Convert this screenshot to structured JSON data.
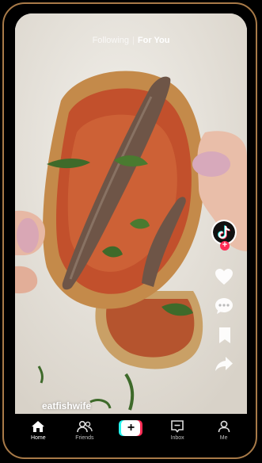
{
  "top_nav": {
    "following": "Following",
    "for_you": "For You"
  },
  "post": {
    "author": "eatfishwife"
  },
  "tabs": [
    {
      "label": "Home",
      "icon": "home-icon"
    },
    {
      "label": "Friends",
      "icon": "friends-icon"
    },
    {
      "label": "",
      "icon": "create-plus-icon"
    },
    {
      "label": "Inbox",
      "icon": "inbox-icon"
    },
    {
      "label": "Me",
      "icon": "profile-icon"
    }
  ],
  "colors": {
    "accent_red": "#fe2c55",
    "accent_cyan": "#25f4ee",
    "bezel": "#a87a48"
  }
}
